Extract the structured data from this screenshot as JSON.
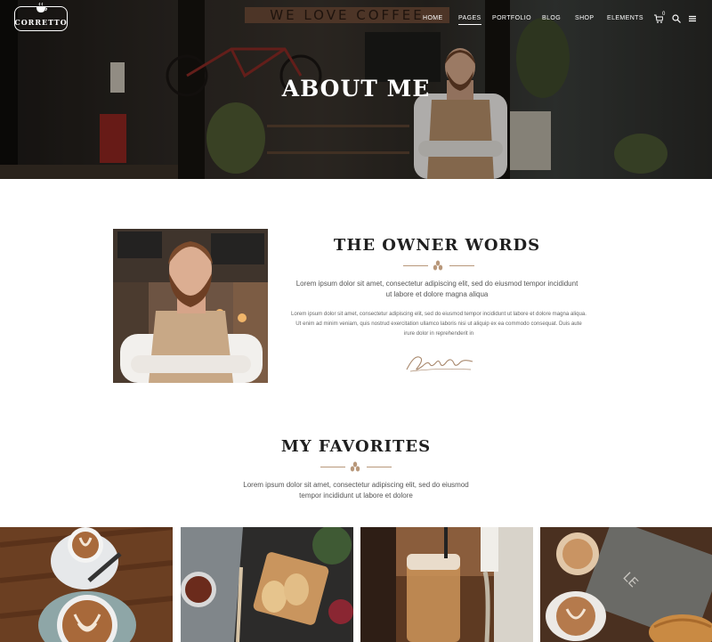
{
  "brand": {
    "name": "CORRETTO"
  },
  "nav": {
    "items": [
      {
        "label": "HOME",
        "active": false
      },
      {
        "label": "PAGES",
        "active": true
      },
      {
        "label": "PORTFOLIO",
        "active": false
      },
      {
        "label": "BLOG",
        "active": false
      },
      {
        "label": "SHOP",
        "active": false
      },
      {
        "label": "ELEMENTS",
        "active": false
      }
    ],
    "cart_count": "0",
    "icons": [
      "cart-icon",
      "search-icon",
      "menu-icon"
    ]
  },
  "hero": {
    "title": "ABOUT ME",
    "sign_text": "WE LOVE COFFEE"
  },
  "owner": {
    "title": "THE OWNER WORDS",
    "lead": "Lorem ipsum dolor sit amet, consectetur adipiscing elit, sed do eiusmod tempor incididunt ut labore et dolore magna aliqua",
    "body": "Lorem ipsum dolor sit amet, consectetur adipiscing elit, sed do eiusmod tempor incididunt ut labore et dolore magna aliqua. Ut enim ad minim veniam, quis nostrud exercitation ullamco laboris nisi ut aliquip ex ea commodo consequat. Duis aute irure dolor in reprehenderit in"
  },
  "favorites": {
    "title": "MY FAVORITES",
    "lead": "Lorem ipsum dolor sit amet, consectetur adipiscing elit, sed do eiusmod tempor incididunt ut labore et dolore"
  },
  "colors": {
    "accent": "#b8977a",
    "heading": "#1f1f1f",
    "text": "#555555"
  }
}
